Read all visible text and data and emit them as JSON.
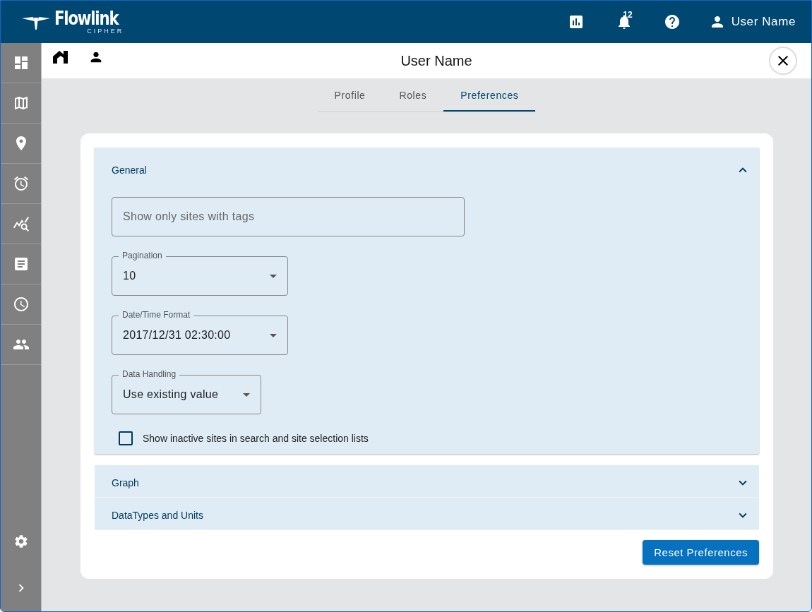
{
  "header": {
    "logo_title": "Flowlink",
    "logo_subtitle": "CIPHER",
    "notification_count": "12",
    "user_name": "User Name"
  },
  "page": {
    "title": "User Name"
  },
  "tabs": [
    {
      "label": "Profile",
      "selected": false
    },
    {
      "label": "Roles",
      "selected": false
    },
    {
      "label": "Preferences",
      "selected": true
    }
  ],
  "sections": [
    {
      "title": "General",
      "expanded": true
    },
    {
      "title": "Graph",
      "expanded": false
    },
    {
      "title": "DataTypes and Units",
      "expanded": false
    }
  ],
  "general": {
    "tags_field": {
      "placeholder": "Show only sites with tags"
    },
    "selects": [
      {
        "label": "Pagination",
        "value": "10"
      },
      {
        "label": "Date/Time Format",
        "value": "2017/12/31 02:30:00"
      },
      {
        "label": "Data Handling",
        "value": "Use existing value"
      }
    ],
    "checkbox": {
      "label": "Show inactive sites in search and site selection lists",
      "checked": false
    }
  },
  "reset_button": "Reset Preferences"
}
